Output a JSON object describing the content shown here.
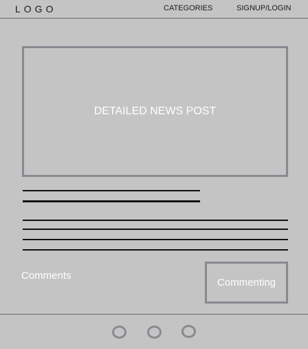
{
  "header": {
    "logo": "LOGO",
    "nav": {
      "categories": "CATEGORIES",
      "signup_login": "SIGNUP/LOGIN"
    }
  },
  "post": {
    "placeholder_label": "DETAILED NEWS POST"
  },
  "comments": {
    "label": "Comments",
    "input_label": "Commenting"
  },
  "pagination": {
    "dot_count": 3
  },
  "colors": {
    "background": "#c4c4c4",
    "box_border": "#8a8890",
    "text_light": "#ffffff",
    "text_dark": "#1a1a1a",
    "rule": "#111111"
  }
}
